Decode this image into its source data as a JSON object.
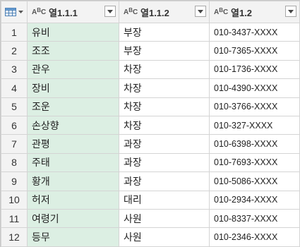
{
  "table_menu": {
    "icon": "table-icon",
    "chevron": "chevron-down-icon"
  },
  "columns": [
    {
      "type_label_top": "A",
      "type_label_sup": "B",
      "type_label_sub": "C",
      "name": "열1.1.1"
    },
    {
      "type_label_top": "A",
      "type_label_sup": "B",
      "type_label_sub": "C",
      "name": "열1.1.2"
    },
    {
      "type_label_top": "A",
      "type_label_sup": "B",
      "type_label_sub": "C",
      "name": "열1.2"
    }
  ],
  "rows": [
    {
      "num": "1",
      "c1": "유비",
      "c2": "부장",
      "c3": "010-3437-XXXX"
    },
    {
      "num": "2",
      "c1": "조조",
      "c2": "부장",
      "c3": "010-7365-XXXX"
    },
    {
      "num": "3",
      "c1": "관우",
      "c2": "차장",
      "c3": "010-1736-XXXX"
    },
    {
      "num": "4",
      "c1": "장비",
      "c2": "차장",
      "c3": "010-4390-XXXX"
    },
    {
      "num": "5",
      "c1": "조운",
      "c2": "차장",
      "c3": "010-3766-XXXX"
    },
    {
      "num": "6",
      "c1": "손상향",
      "c2": "차장",
      "c3": "010-327-XXXX"
    },
    {
      "num": "7",
      "c1": "관평",
      "c2": "과장",
      "c3": "010-6398-XXXX"
    },
    {
      "num": "8",
      "c1": "주태",
      "c2": "과장",
      "c3": "010-7693-XXXX"
    },
    {
      "num": "9",
      "c1": "황개",
      "c2": "과장",
      "c3": "010-5086-XXXX"
    },
    {
      "num": "10",
      "c1": "허저",
      "c2": "대리",
      "c3": "010-2934-XXXX"
    },
    {
      "num": "11",
      "c1": "여령기",
      "c2": "사원",
      "c3": "010-8337-XXXX"
    },
    {
      "num": "12",
      "c1": "등무",
      "c2": "사원",
      "c3": "010-2346-XXXX"
    }
  ],
  "colors": {
    "selected_column": "#dcefe3",
    "header_bg": "#f3f3f3",
    "grid_line": "#d4d4d4"
  }
}
